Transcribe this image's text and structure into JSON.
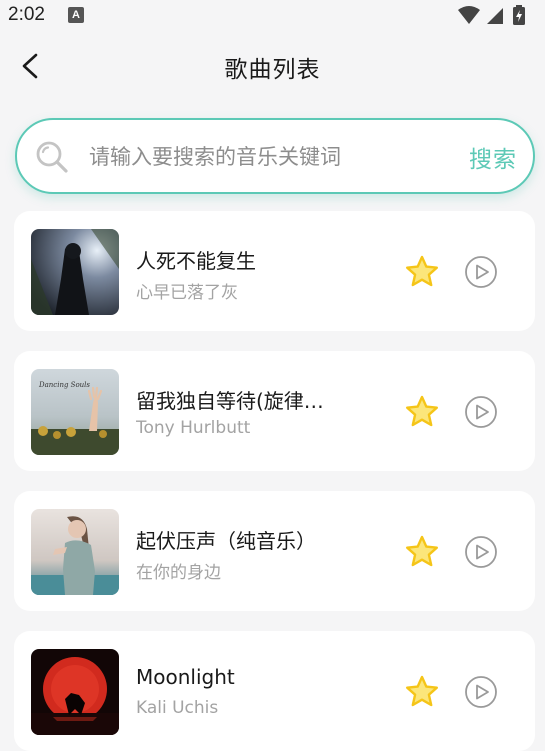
{
  "status_bar": {
    "time": "2:02",
    "notification_icon_letter": "A"
  },
  "header": {
    "title": "歌曲列表",
    "back_icon": "chevron-left-icon"
  },
  "search": {
    "placeholder": "请输入要搜索的音乐关键词",
    "button_label": "搜索",
    "accent_color": "#5cc9b6"
  },
  "songs": [
    {
      "title": "人死不能复生",
      "artist": "心早已落了灰"
    },
    {
      "title": "留我独自等待(旋律…",
      "artist": "Tony Hurlbutt",
      "cover_text": "Dancing Souls"
    },
    {
      "title": "起伏压声（纯音乐）",
      "artist": "在你的身边"
    },
    {
      "title": "Moonlight",
      "artist": "Kali Uchis"
    }
  ],
  "icons": {
    "favorite": "star-icon",
    "play": "play-circle-icon",
    "star_color": "#f5c518"
  }
}
